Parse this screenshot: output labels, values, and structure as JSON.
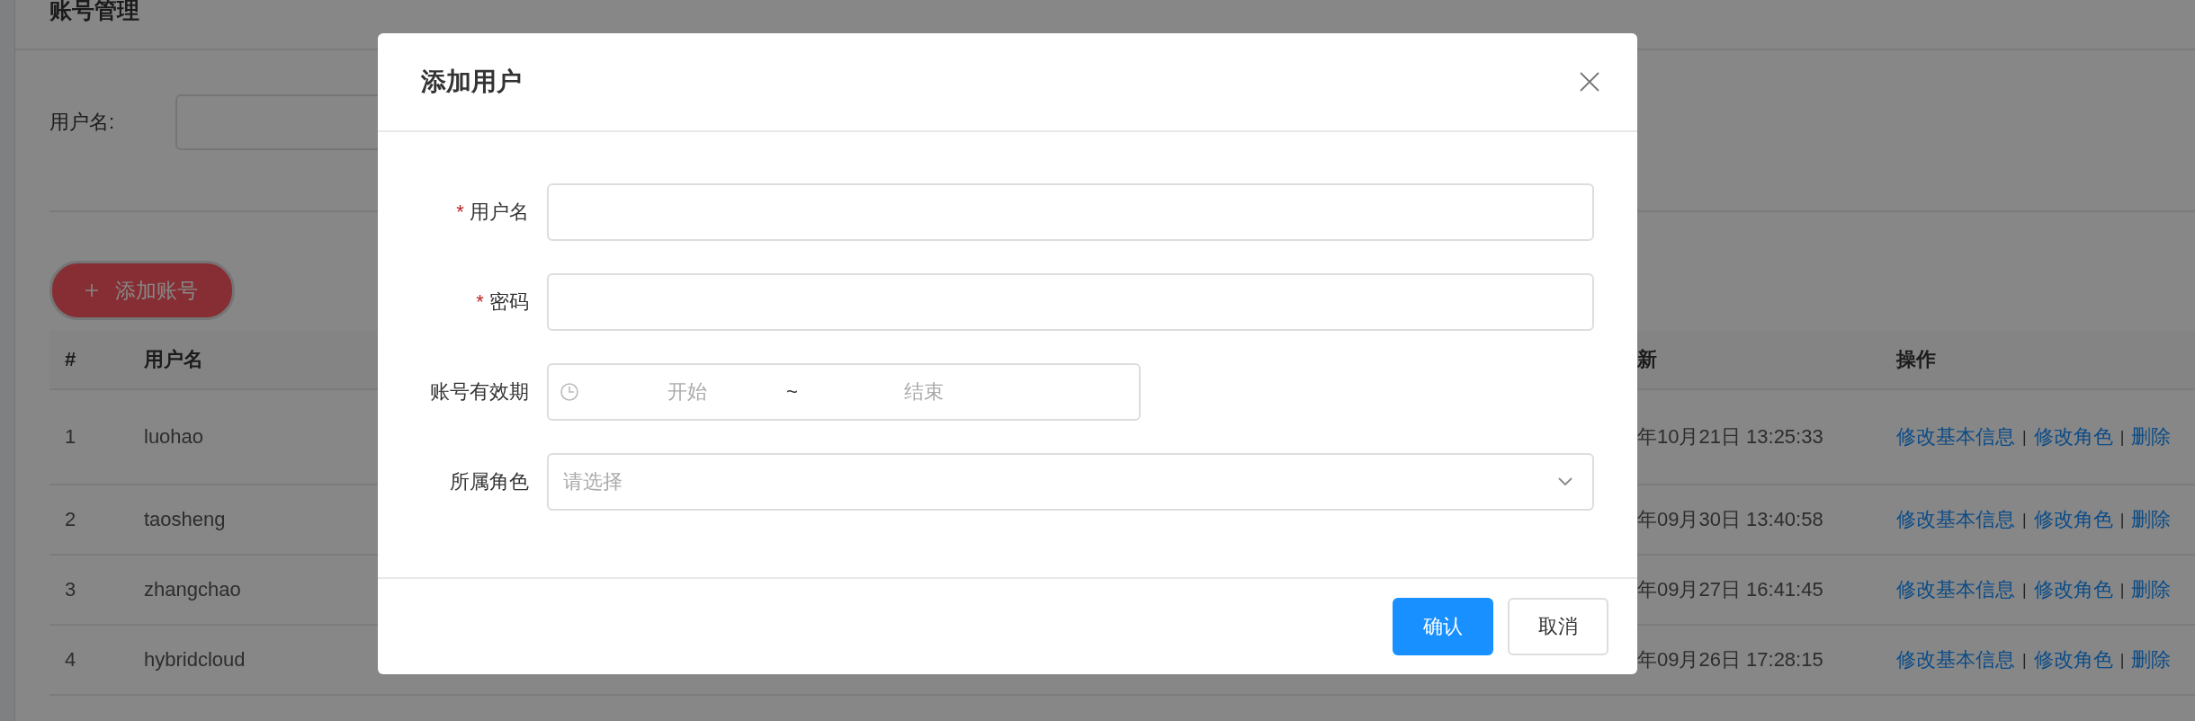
{
  "page": {
    "title": "账号管理"
  },
  "search": {
    "label": "用户名:"
  },
  "add_button": {
    "label": "添加账号"
  },
  "table": {
    "columns": [
      "#",
      "用户名",
      "新",
      "操作"
    ],
    "rows": [
      {
        "index": "1",
        "username": "luohao",
        "updated": "年10月21日 13:25:33",
        "actions": [
          {
            "kind": "link",
            "text": "修改基本信息"
          },
          {
            "kind": "separator",
            "text": "|"
          },
          {
            "kind": "link",
            "text": "修改角色"
          },
          {
            "kind": "separator",
            "text": "|"
          },
          {
            "kind": "link",
            "text": "删除"
          }
        ]
      },
      {
        "index": "2",
        "username": "taosheng",
        "updated": "年09月30日 13:40:58",
        "actions": [
          {
            "kind": "link",
            "text": "修改基本信息"
          },
          {
            "kind": "separator",
            "text": "|"
          },
          {
            "kind": "link",
            "text": "修改角色"
          },
          {
            "kind": "separator",
            "text": "|"
          },
          {
            "kind": "link",
            "text": "删除"
          }
        ]
      },
      {
        "index": "3",
        "username": "zhangchao",
        "updated": "年09月27日 16:41:45",
        "actions": [
          {
            "kind": "link",
            "text": "修改基本信息"
          },
          {
            "kind": "separator",
            "text": "|"
          },
          {
            "kind": "link",
            "text": "修改角色"
          },
          {
            "kind": "separator",
            "text": "|"
          },
          {
            "kind": "link",
            "text": "删除"
          }
        ]
      },
      {
        "index": "4",
        "username": "hybridcloud",
        "updated": "年09月26日 17:28:15",
        "actions": [
          {
            "kind": "link",
            "text": "修改基本信息"
          },
          {
            "kind": "separator",
            "text": "|"
          },
          {
            "kind": "link",
            "text": "修改角色"
          },
          {
            "kind": "separator",
            "text": "|"
          },
          {
            "kind": "link",
            "text": "删除"
          }
        ]
      }
    ]
  },
  "dialog": {
    "title": "添加用户",
    "fields": [
      {
        "kind": "text",
        "mark": "*",
        "label": "用户名"
      },
      {
        "kind": "text",
        "mark": "*",
        "label": "密码"
      },
      {
        "kind": "daterange",
        "label": "账号有效期",
        "start_placeholder": "开始",
        "separator": "~",
        "end_placeholder": "结束"
      },
      {
        "kind": "select",
        "label": "所属角色",
        "placeholder": "请选择"
      }
    ],
    "buttons": [
      {
        "kind": "primary",
        "label": "确认"
      },
      {
        "kind": "default",
        "label": "取消"
      }
    ]
  }
}
